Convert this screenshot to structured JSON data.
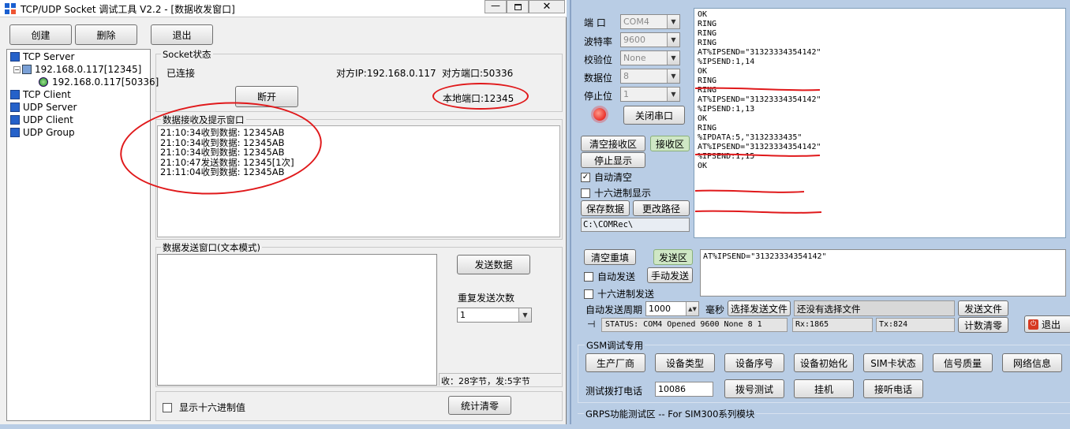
{
  "left": {
    "title": "TCP/UDP Socket 调试工具 V2.2 - [数据收发窗口]",
    "toolbar": {
      "create": "创建",
      "delete": "删除",
      "exit": "退出"
    },
    "tree": {
      "tcp_server": "TCP Server",
      "server_ip": "192.168.0.117[12345]",
      "client_ip": "192.168.0.117[50336]",
      "tcp_client": "TCP Client",
      "udp_server": "UDP Server",
      "udp_client": "UDP Client",
      "udp_group": "UDP Group"
    },
    "socket": {
      "group_label": "Socket状态",
      "status": "已连接",
      "peer_ip": "对方IP:192.168.0.117",
      "peer_port": "对方端口:50336",
      "disconnect": "断开",
      "local_port": "本地端口:12345"
    },
    "recv": {
      "group_label": "数据接收及提示窗口",
      "lines": [
        "21:10:34收到数据: 12345AB",
        "21:10:34收到数据: 12345AB",
        "21:10:34收到数据: 12345AB",
        "21:10:47发送数据: 12345[1次]",
        "21:11:04收到数据: 12345AB"
      ]
    },
    "send": {
      "group_label": "数据发送窗口(文本模式)",
      "send_button": "发送数据",
      "repeat_label": "重复发送次数",
      "repeat_value": "1",
      "stats": "收：28字节，发:5字节"
    },
    "bottom": {
      "hex_label": "显示十六进制值",
      "clear_stats": "统计清零"
    }
  },
  "right": {
    "settings": {
      "port_label": "端 口",
      "port_value": "COM4",
      "baud_label": "波特率",
      "baud_value": "9600",
      "parity_label": "校验位",
      "parity_value": "None",
      "databits_label": "数据位",
      "databits_value": "8",
      "stopbits_label": "停止位",
      "stopbits_value": "1",
      "close_port": "关闭串口"
    },
    "recv_controls": {
      "clear_recv": "清空接收区",
      "recv_area": "接收区",
      "stop_display": "停止显示",
      "auto_clear": "自动清空",
      "hex_display": "十六进制显示",
      "save_data": "保存数据",
      "change_path": "更改路径",
      "path": "C:\\COMRec\\"
    },
    "recv_log": [
      "OK",
      "",
      "RING",
      "",
      "RING",
      "",
      "RING",
      "AT%IPSEND=\"31323334354142\"",
      "%IPSEND:1,14",
      "OK",
      "",
      "RING",
      "",
      "RING",
      "AT%IPSEND=\"31323334354142\"",
      "%IPSEND:1,13",
      "OK",
      "",
      "RING",
      "%IPDATA:5,\"3132333435\"",
      "AT%IPSEND=\"31323334354142\"",
      "%IPSEND:1,15",
      "OK"
    ],
    "send_controls": {
      "clear_resend": "清空重填",
      "send_area": "发送区",
      "auto_send": "自动发送",
      "manual_send": "手动发送",
      "hex_send": "十六进制发送",
      "send_text": "AT%IPSEND=\"31323334354142\""
    },
    "period": {
      "label": "自动发送周期",
      "value": "1000",
      "unit": "毫秒",
      "choose_file": "选择发送文件",
      "file_status": "还没有选择文件",
      "send_file": "发送文件"
    },
    "status": {
      "text": "STATUS: COM4 Opened 9600 None 8 1",
      "rx": "Rx:1865",
      "tx": "Tx:824",
      "reset_count": "计数清零",
      "exit": "退出"
    },
    "gsm": {
      "group_label": "GSM调试专用",
      "buttons": [
        "生产厂商",
        "设备类型",
        "设备序号",
        "设备初始化",
        "SIM卡状态",
        "信号质量",
        "网络信息"
      ],
      "dial_label": "测试拨打电话",
      "dial_value": "10086",
      "dial_test": "拨号测试",
      "hangup": "挂机",
      "answer": "接听电话"
    },
    "gprs": {
      "group_label": "GRPS功能测试区 -- For SIM300系列模块"
    }
  },
  "colors": {
    "annotation": "#e0191b",
    "serial_bg": "#b9cde5",
    "window_bg": "#f0f0f0"
  }
}
